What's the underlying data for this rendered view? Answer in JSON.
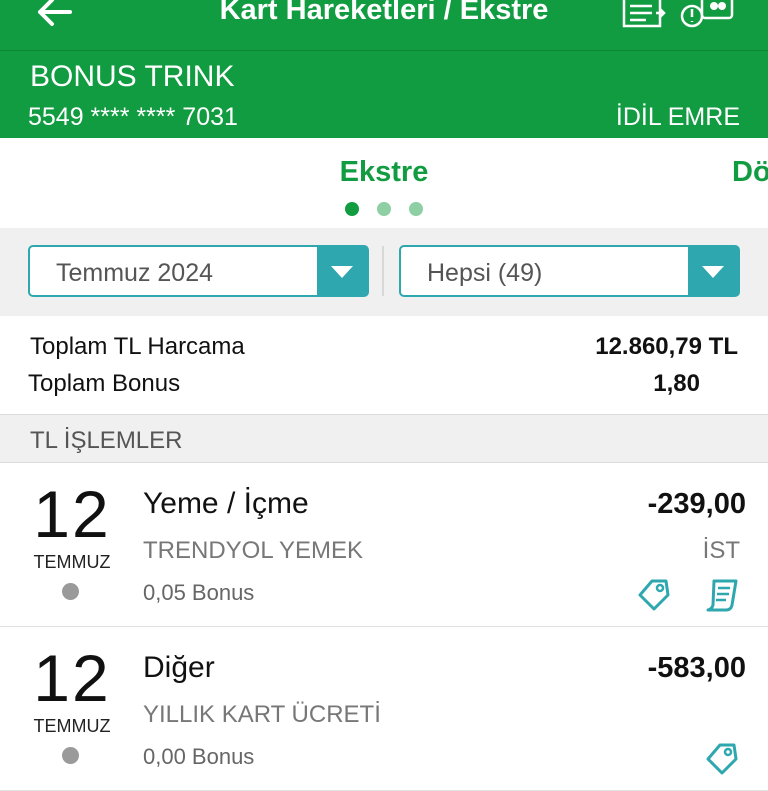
{
  "header": {
    "title": "Kart Hareketleri / Ekstre",
    "back_icon": "back-arrow-icon",
    "list_icon": "list-icon",
    "card_icon": "card-info-icon"
  },
  "card": {
    "name": "BONUS TRINK",
    "number": "5549 **** **** 7031",
    "holder": "İDİL EMRE"
  },
  "tabs": {
    "active": "Ekstre",
    "next_partial": "Dö",
    "page_count": 3,
    "active_index": 0
  },
  "filters": {
    "period": "Temmuz 2024",
    "type": "Hepsi (49)"
  },
  "summary": {
    "total_spend_label": "Toplam TL Harcama",
    "total_spend_value": "12.860,79 TL",
    "total_bonus_label": "Toplam Bonus",
    "total_bonus_value": "1,80"
  },
  "section_title": "TL İŞLEMLER",
  "transactions": [
    {
      "day": "12",
      "month": "TEMMUZ",
      "category": "Yeme / İçme",
      "merchant": "TRENDYOL YEMEK",
      "bonus": "0,05 Bonus",
      "amount": "-239,00",
      "city": "İST"
    },
    {
      "day": "12",
      "month": "TEMMUZ",
      "category": "Diğer",
      "merchant": "YILLIK KART ÜCRETİ",
      "bonus": "0,00 Bonus",
      "amount": "-583,00",
      "city": ""
    }
  ],
  "colors": {
    "brand_green": "#119c41",
    "teal": "#2ea7ae",
    "status_grey": "#9a9a9a"
  }
}
